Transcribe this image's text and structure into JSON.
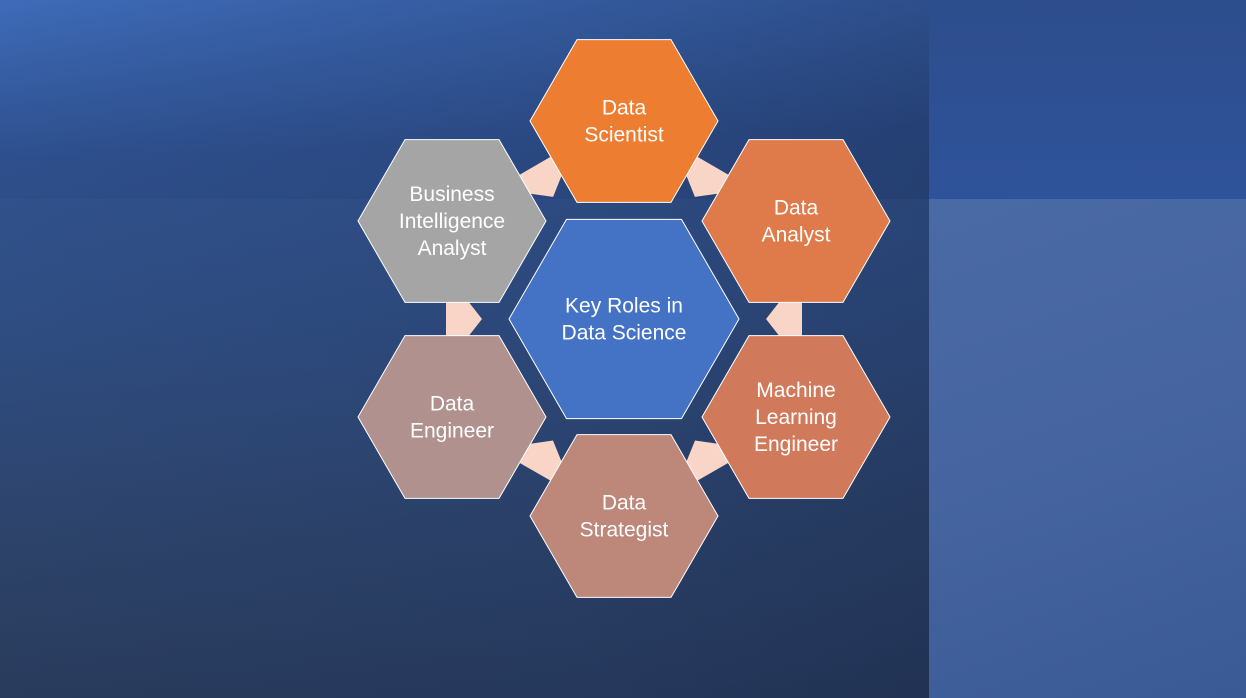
{
  "center": {
    "lines": [
      "Key Roles in",
      "Data Science"
    ],
    "color": "#4472c4"
  },
  "roles": [
    {
      "id": "data-scientist",
      "lines": [
        "Data",
        "Scientist"
      ],
      "color": "#ed7d31"
    },
    {
      "id": "data-analyst",
      "lines": [
        "Data",
        "Analyst"
      ],
      "color": "#df7b4a"
    },
    {
      "id": "machine-learning-engineer",
      "lines": [
        "Machine",
        "Learning",
        "Engineer"
      ],
      "color": "#d07a5b"
    },
    {
      "id": "data-strategist",
      "lines": [
        "Data",
        "Strategist"
      ],
      "color": "#bd877a"
    },
    {
      "id": "data-engineer",
      "lines": [
        "Data",
        "Engineer"
      ],
      "color": "#b0918e"
    },
    {
      "id": "business-intelligence-analyst",
      "lines": [
        "Business",
        "Intelligence",
        "Analyst"
      ],
      "color": "#a5a5a5"
    }
  ],
  "connector_color": "#f8d5c6"
}
